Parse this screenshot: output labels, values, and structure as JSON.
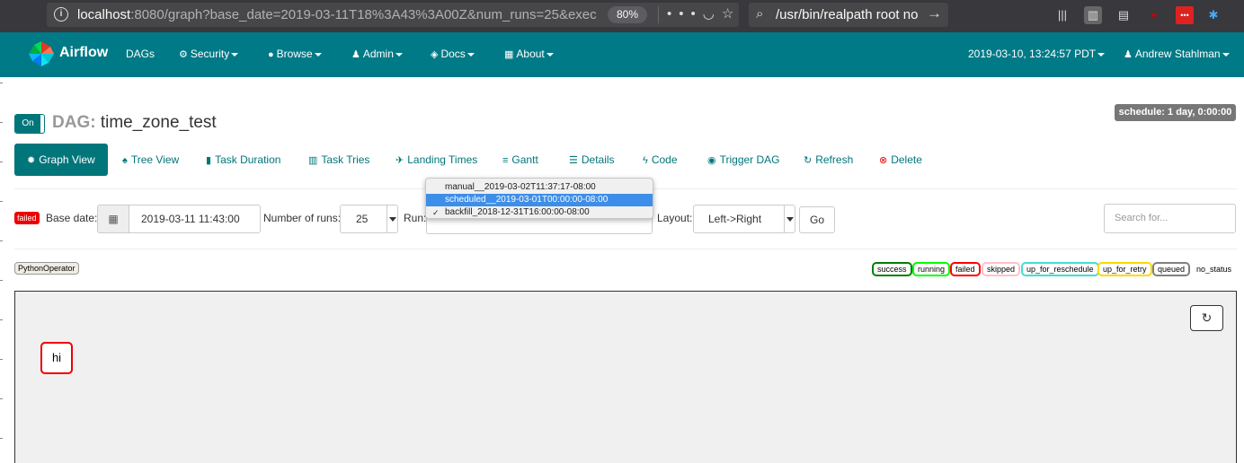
{
  "browser": {
    "url_host": "localhost",
    "url_rest": ":8080/graph?base_date=2019-03-11T18%3A43%3A00Z&num_runs=25&exec",
    "zoom": "80%",
    "search_query": "/usr/bin/realpath root no s"
  },
  "navbar": {
    "brand": "Airflow",
    "items": [
      {
        "label": "DAGs",
        "icon": ""
      },
      {
        "label": "Security",
        "icon": "gears-icon"
      },
      {
        "label": "Browse",
        "icon": "globe-icon"
      },
      {
        "label": "Admin",
        "icon": "user-icon"
      },
      {
        "label": "Docs",
        "icon": "cube-icon"
      },
      {
        "label": "About",
        "icon": "grid-icon"
      }
    ],
    "datetime": "2019-03-10, 13:24:57 PDT",
    "user": "Andrew Stahlman"
  },
  "dag": {
    "toggle_label": "On",
    "title_prefix": "DAG:",
    "title": "time_zone_test",
    "schedule": "schedule: 1 day, 0:00:00"
  },
  "tabs": [
    {
      "label": "Graph View",
      "icon": "sun-icon",
      "active": true
    },
    {
      "label": "Tree View",
      "icon": "tree-icon"
    },
    {
      "label": "Task Duration",
      "icon": "bar-chart-icon"
    },
    {
      "label": "Task Tries",
      "icon": "barcode-icon"
    },
    {
      "label": "Landing Times",
      "icon": "plane-icon"
    },
    {
      "label": "Gantt",
      "icon": "gantt-icon"
    },
    {
      "label": "Details",
      "icon": "list-icon"
    },
    {
      "label": "Code",
      "icon": "flash-icon"
    },
    {
      "label": "Trigger DAG",
      "icon": "play-circle-icon"
    },
    {
      "label": "Refresh",
      "icon": "refresh-icon"
    },
    {
      "label": "Delete",
      "icon": "remove-circle-icon"
    }
  ],
  "form": {
    "status_badge": "failed",
    "base_date_label": "Base date:",
    "base_date_value": "2019-03-11 11:43:00",
    "num_runs_label": "Number of runs:",
    "num_runs_value": "25",
    "run_label": "Run:",
    "run_options": [
      {
        "label": "manual__2019-03-02T11:37:17-08:00",
        "selected": false,
        "checked": false
      },
      {
        "label": "scheduled__2019-03-01T00:00:00-08:00",
        "selected": true,
        "checked": false
      },
      {
        "label": "backfill_2018-12-31T16:00:00-08:00",
        "selected": false,
        "checked": true
      }
    ],
    "layout_label": "Layout:",
    "layout_value": "Left->Right",
    "go_label": "Go",
    "search_placeholder": "Search for..."
  },
  "operator_tag": "PythonOperator",
  "legend": [
    {
      "label": "success",
      "color": "#008000"
    },
    {
      "label": "running",
      "color": "#00ff00"
    },
    {
      "label": "failed",
      "color": "#ff0000"
    },
    {
      "label": "skipped",
      "color": "#ffc0cb"
    },
    {
      "label": "up_for_reschedule",
      "color": "#40e0d0"
    },
    {
      "label": "up_for_retry",
      "color": "#ffd700"
    },
    {
      "label": "queued",
      "color": "#808080"
    },
    {
      "label": "no_status",
      "color": "#ffffff"
    }
  ],
  "graph": {
    "task_label": "hi",
    "task_state_color": "#ff0000"
  }
}
